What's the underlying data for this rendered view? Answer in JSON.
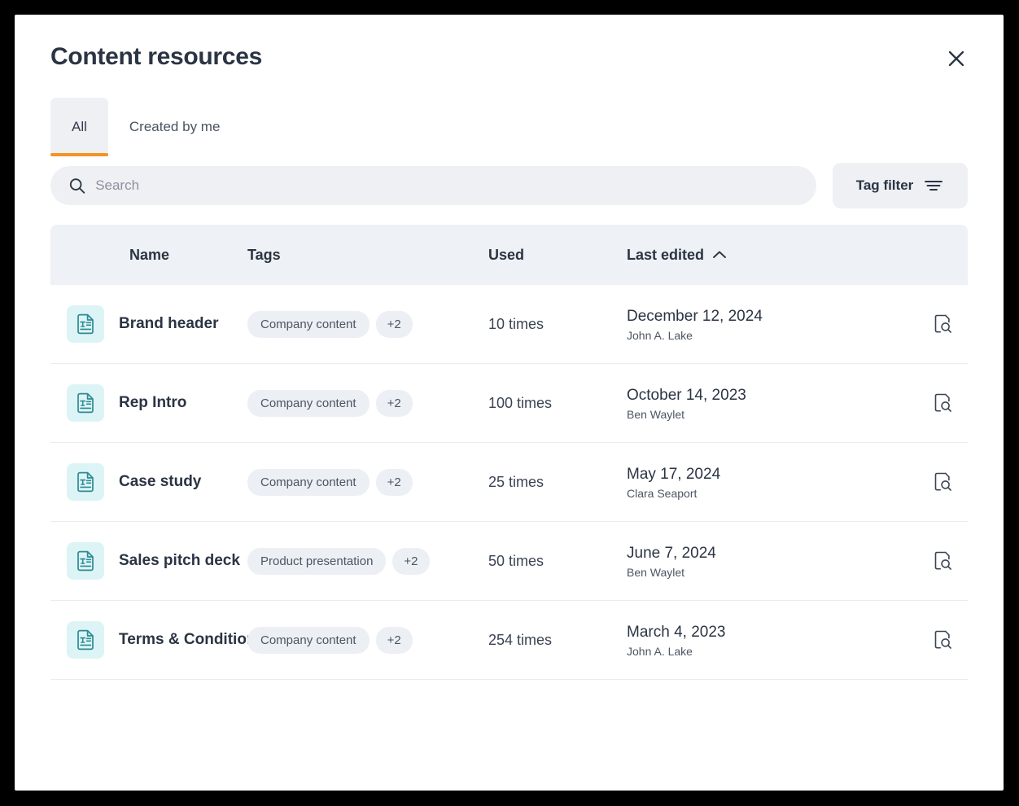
{
  "modal": {
    "title": "Content resources",
    "close_icon": "close-icon"
  },
  "tabs": [
    {
      "label": "All",
      "active": true
    },
    {
      "label": "Created by me",
      "active": false
    }
  ],
  "search": {
    "placeholder": "Search",
    "value": "",
    "icon": "search-icon"
  },
  "tag_filter": {
    "label": "Tag filter",
    "icon": "filter-icon"
  },
  "table": {
    "columns": {
      "name": "Name",
      "tags": "Tags",
      "used": "Used",
      "last_edited": "Last edited"
    },
    "sort": {
      "column": "Last edited",
      "direction": "asc",
      "icon": "chevron-up-icon"
    },
    "rows": [
      {
        "icon": "text-document-icon",
        "name": "Brand header",
        "tag": "Company content",
        "tag_more": "+2",
        "used": "10 times",
        "date": "December 12, 2024",
        "author": "John A. Lake",
        "action_icon": "document-preview-icon"
      },
      {
        "icon": "text-document-icon",
        "name": "Rep Intro",
        "tag": "Company content",
        "tag_more": "+2",
        "used": "100 times",
        "date": "October 14, 2023",
        "author": "Ben Waylet",
        "action_icon": "document-preview-icon"
      },
      {
        "icon": "text-document-icon",
        "name": "Case study",
        "tag": "Company content",
        "tag_more": "+2",
        "used": "25 times",
        "date": "May 17, 2024",
        "author": "Clara Seaport",
        "action_icon": "document-preview-icon"
      },
      {
        "icon": "text-document-icon",
        "name": "Sales pitch deck",
        "tag": "Product presentation",
        "tag_more": "+2",
        "used": "50 times",
        "date": "June 7, 2024",
        "author": "Ben Waylet",
        "action_icon": "document-preview-icon"
      },
      {
        "icon": "text-document-icon",
        "name": "Terms & Conditions",
        "tag": "Company content",
        "tag_more": "+2",
        "used": "254 times",
        "date": "March 4, 2023",
        "author": "John A. Lake",
        "action_icon": "document-preview-icon"
      }
    ]
  },
  "colors": {
    "accent": "#f59324",
    "text_primary": "#2b3443",
    "text_secondary": "#4c5563",
    "surface_muted": "#eef0f4",
    "table_header": "#eef1f5",
    "icon_teal": "#2c8b92",
    "icon_teal_bg": "#ddf4f6",
    "page_border": "#000000"
  }
}
